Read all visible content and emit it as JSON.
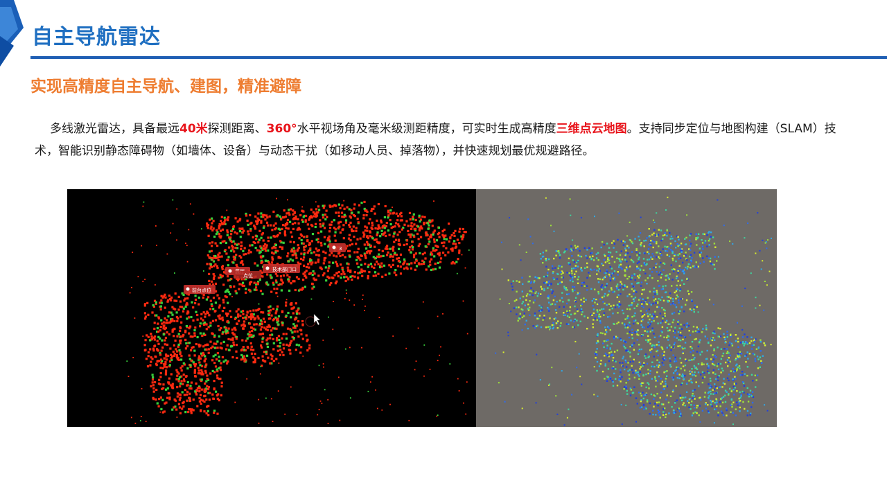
{
  "header": {
    "title": "自主导航雷达",
    "subtitle": "实现高精度自主导航、建图，精准避障"
  },
  "description": {
    "seg1": "多线激光雷达，具备最远",
    "hl1": "40米",
    "seg2": "探测距离、",
    "hl2": "360°",
    "seg3": "水平视场角及毫米级测距精度，可实时生成高精度",
    "hl3": "三维点云地图",
    "seg4": "。支持同步定位与地图构建（SLAM）技术，智能识别静态障碍物（如墙体、设备）与动态干扰（如移动人员、掉落物），并快速规划最优规避路径。"
  },
  "images": {
    "left_markers": [
      {
        "label": "前台点位"
      },
      {
        "label": "展厅"
      },
      {
        "label": "技术部门口"
      },
      {
        "label": "3"
      },
      {
        "label": "点位"
      }
    ]
  },
  "colors": {
    "title": "#1f6fc1",
    "rule": "#1f5fb4",
    "subtitle": "#ee7d31",
    "highlight": "#e8141b",
    "pointcloud_red": "#ff2a10",
    "pointcloud_green": "#38d23c"
  }
}
